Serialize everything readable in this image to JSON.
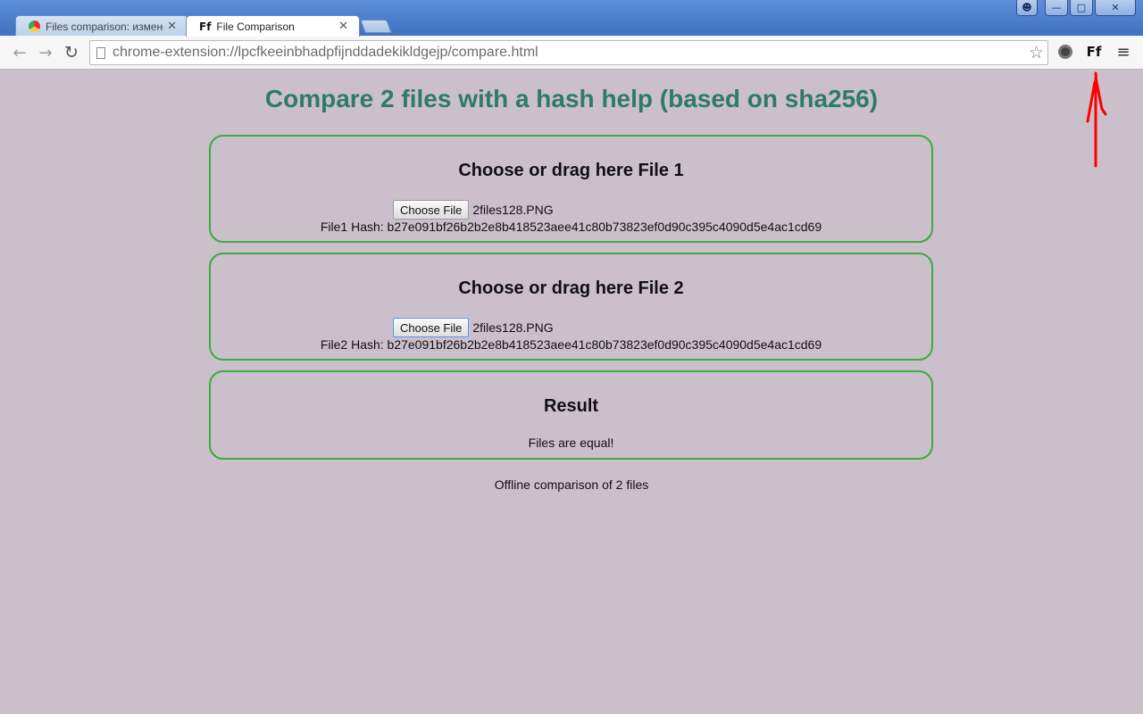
{
  "browser": {
    "tabs": [
      {
        "label": "Files comparison: изменение",
        "icon": "colorful-favicon-icon"
      },
      {
        "label": "File Comparison",
        "icon": "ff-favicon-icon"
      }
    ],
    "favicon_ff": "Ff",
    "url": "chrome-extension://lpcfkeeinbhadpfijnddadekikldgejp/compare.html",
    "extension_label": "Ff"
  },
  "page": {
    "title": "Compare 2 files with a hash help (based on sha256)",
    "file1": {
      "heading": "Choose or drag here File 1",
      "button_label": "Choose File",
      "file_name": "2files128.PNG",
      "hash_label": "File1 Hash: b27e091bf26b2b2e8b418523aee41c80b73823ef0d90c395c4090d5e4ac1cd69"
    },
    "file2": {
      "heading": "Choose or drag here File 2",
      "button_label": "Choose File",
      "file_name": "2files128.PNG",
      "hash_label": "File2 Hash: b27e091bf26b2b2e8b418523aee41c80b73823ef0d90c395c4090d5e4ac1cd69"
    },
    "result": {
      "heading": "Result",
      "text": "Files are equal!"
    },
    "footer": "Offline comparison of 2 files"
  },
  "colors": {
    "page_background": "#cbbfcc",
    "title": "#2e7b66",
    "panel_border": "#3cab3c",
    "annotation_arrow": "#ff0000"
  }
}
